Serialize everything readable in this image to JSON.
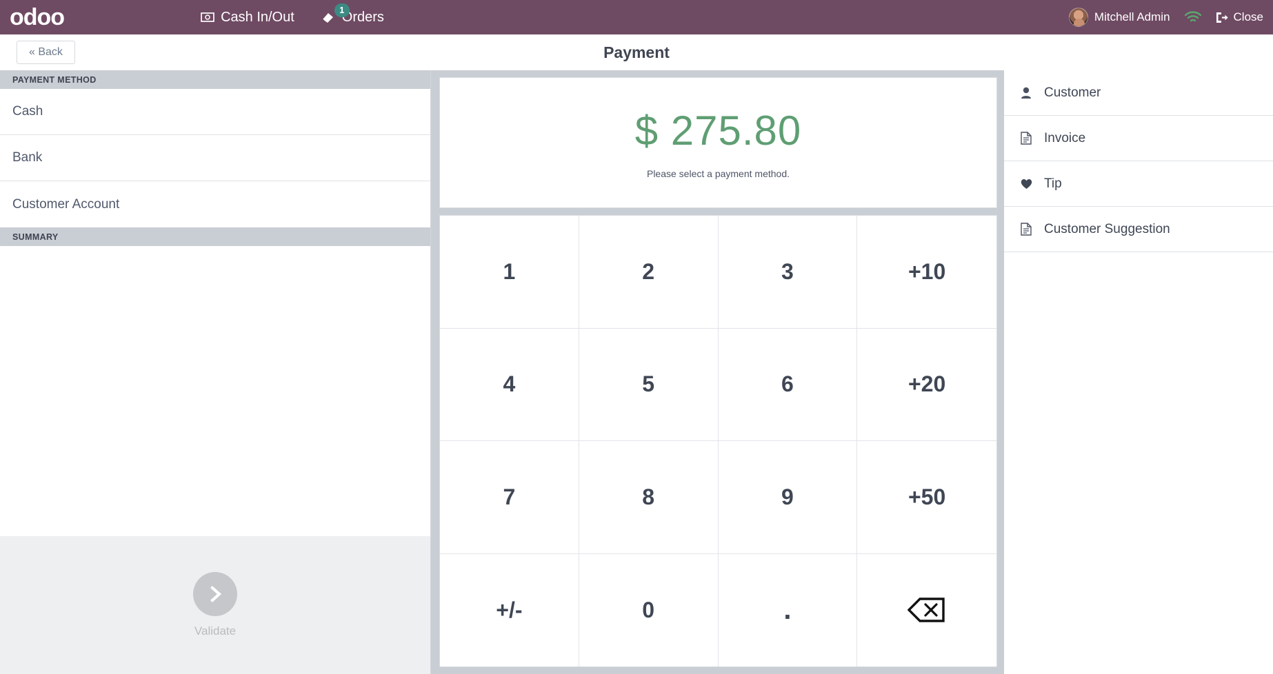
{
  "header": {
    "logo_text": "odoo",
    "nav": [
      {
        "label": "Cash In/Out",
        "icon": "cash-icon",
        "badge": ""
      },
      {
        "label": "Orders",
        "icon": "orders-icon",
        "badge": "1"
      }
    ],
    "user_name": "Mitchell Admin",
    "wifi_icon": "wifi-icon",
    "close_label": "Close",
    "bar_color": "#6f4a63",
    "badge_color": "#3b8b84",
    "wifi_color": "#5aa86d"
  },
  "titlebar": {
    "back_label": "« Back",
    "title": "Payment"
  },
  "left": {
    "payment_method_header": "PAYMENT METHOD",
    "methods": [
      {
        "label": "Cash"
      },
      {
        "label": "Bank"
      },
      {
        "label": "Customer Account"
      }
    ],
    "summary_header": "SUMMARY",
    "validate_label": "Validate",
    "validate_icon": "chevron-right-icon",
    "validate_disabled": "true"
  },
  "payment": {
    "amount": "$ 275.80",
    "amount_color": "#5f9e73",
    "note": "Please select a payment method.",
    "numpad": [
      {
        "label": "1",
        "name": "numpad-key-1"
      },
      {
        "label": "2",
        "name": "numpad-key-2"
      },
      {
        "label": "3",
        "name": "numpad-key-3"
      },
      {
        "label": "+10",
        "name": "numpad-key-plus-10"
      },
      {
        "label": "4",
        "name": "numpad-key-4"
      },
      {
        "label": "5",
        "name": "numpad-key-5"
      },
      {
        "label": "6",
        "name": "numpad-key-6"
      },
      {
        "label": "+20",
        "name": "numpad-key-plus-20"
      },
      {
        "label": "7",
        "name": "numpad-key-7"
      },
      {
        "label": "8",
        "name": "numpad-key-8"
      },
      {
        "label": "9",
        "name": "numpad-key-9"
      },
      {
        "label": "+50",
        "name": "numpad-key-plus-50"
      },
      {
        "label": "+/-",
        "name": "numpad-key-sign"
      },
      {
        "label": "0",
        "name": "numpad-key-0"
      },
      {
        "label": ".",
        "name": "numpad-key-decimal"
      },
      {
        "label": "⌫",
        "name": "numpad-key-backspace"
      }
    ]
  },
  "right_panel": {
    "items": [
      {
        "label": "Customer",
        "icon": "person-icon"
      },
      {
        "label": "Invoice",
        "icon": "document-icon"
      },
      {
        "label": "Tip",
        "icon": "heart-icon"
      },
      {
        "label": "Customer Suggestion",
        "icon": "document-icon"
      }
    ]
  }
}
